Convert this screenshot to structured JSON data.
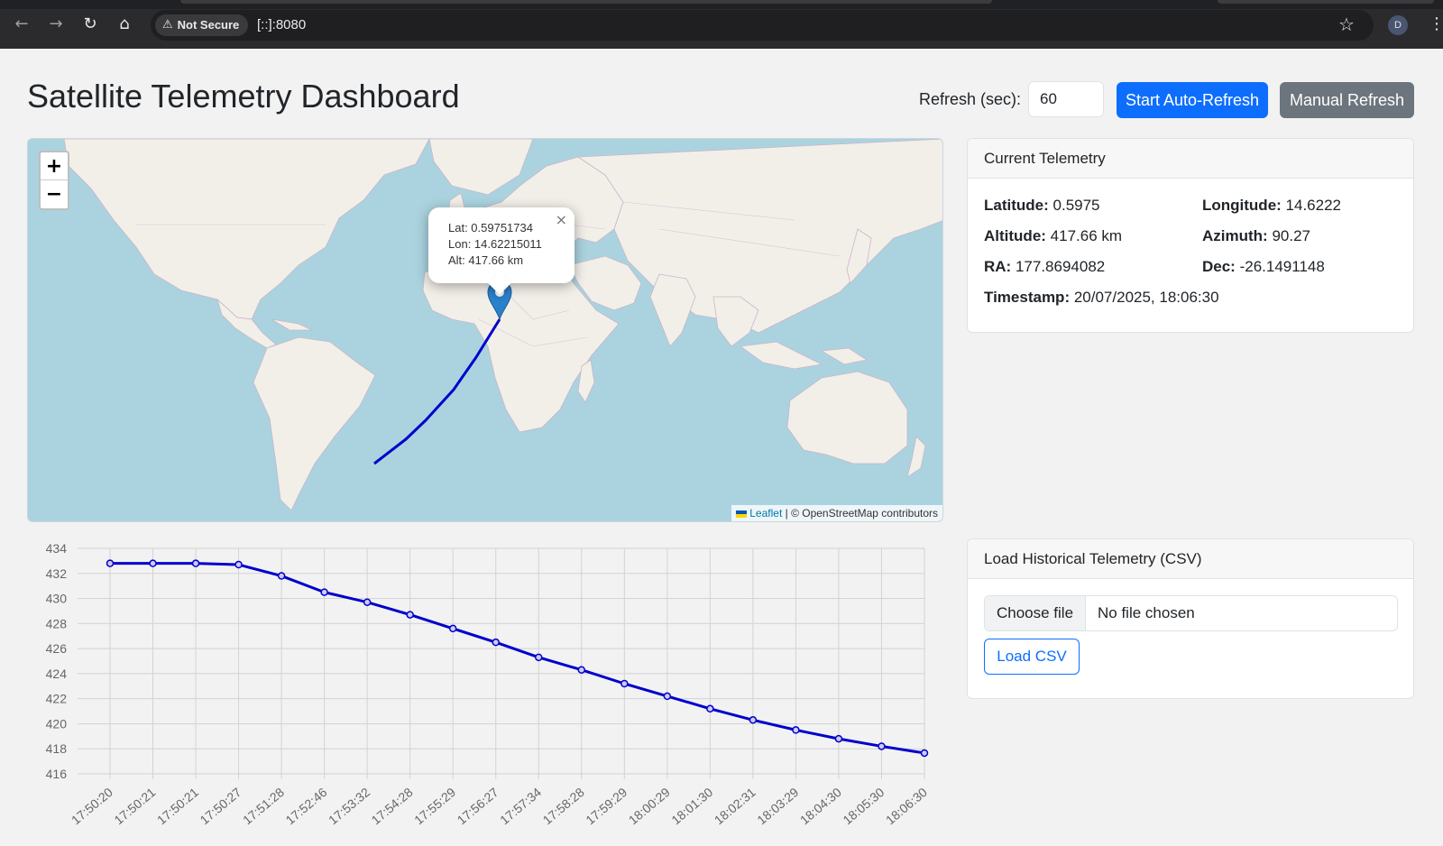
{
  "browser": {
    "security_label": "Not Secure",
    "url": "[::]:8080",
    "profile_initial": "D",
    "icons": [
      "back-icon",
      "forward-icon",
      "reload-icon",
      "home-icon",
      "warning-icon",
      "star-icon",
      "kebab-menu-icon"
    ]
  },
  "header": {
    "title": "Satellite Telemetry Dashboard",
    "refresh_label": "Refresh (sec):",
    "refresh_value": "60",
    "auto_refresh_label": "Start Auto-Refresh",
    "manual_refresh_label": "Manual Refresh"
  },
  "map": {
    "zoom_in": "+",
    "zoom_out": "−",
    "popup": {
      "close": "×",
      "lat": "Lat: 0.59751734",
      "lon": "Lon: 14.62215011",
      "alt": "Alt: 417.66 km"
    },
    "attribution_link": "Leaflet",
    "attribution_text": "| © OpenStreetMap contributors",
    "track_color": "#0000cc",
    "marker_color": "#2a81cb"
  },
  "telemetry": {
    "title": "Current Telemetry",
    "latitude_label": "Latitude:",
    "latitude": "0.5975",
    "longitude_label": "Longitude:",
    "longitude": "14.6222",
    "altitude_label": "Altitude:",
    "altitude": "417.66 km",
    "azimuth_label": "Azimuth:",
    "azimuth": "90.27",
    "ra_label": "RA:",
    "ra": "177.8694082",
    "dec_label": "Dec:",
    "dec": "-26.1491148",
    "timestamp_label": "Timestamp:",
    "timestamp": "20/07/2025, 18:06:30"
  },
  "historical": {
    "title": "Load Historical Telemetry (CSV)",
    "choose_file": "Choose file",
    "no_file": "No file chosen",
    "load_label": "Load CSV"
  },
  "chart_data": {
    "type": "line",
    "x": [
      "17:50:20",
      "17:50:21",
      "17:50:21",
      "17:50:27",
      "17:51:28",
      "17:52:46",
      "17:53:32",
      "17:54:28",
      "17:55:29",
      "17:56:27",
      "17:57:34",
      "17:58:28",
      "17:59:29",
      "18:00:29",
      "18:01:30",
      "18:02:31",
      "18:03:29",
      "18:04:30",
      "18:05:30",
      "18:06:30"
    ],
    "series": [
      {
        "values": [
          432.8,
          432.8,
          432.8,
          432.7,
          431.8,
          430.5,
          429.7,
          428.7,
          427.6,
          426.5,
          425.3,
          424.3,
          423.2,
          422.2,
          421.2,
          420.3,
          419.5,
          418.8,
          418.2,
          417.66
        ],
        "color": "#0000cc"
      }
    ],
    "yticks": [
      "434",
      "432",
      "430",
      "428",
      "426",
      "424",
      "422",
      "420",
      "418",
      "416"
    ],
    "ylim": [
      416,
      434
    ],
    "grid": true,
    "legend": "none"
  }
}
